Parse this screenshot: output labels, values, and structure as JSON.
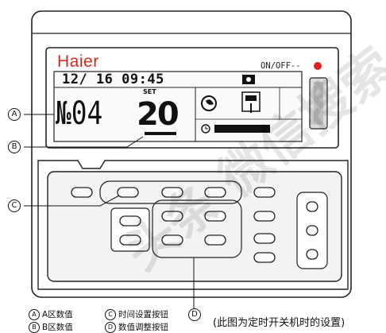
{
  "display": {
    "brand": "Haier",
    "on_off_label": "ON/OFF--",
    "datetime": "12/ 16 09:45",
    "zone_a_value": "№04",
    "set_label": "SET",
    "zone_b_value": "20"
  },
  "callouts": {
    "a": "A",
    "b": "B",
    "c": "C",
    "d": "D"
  },
  "legend": [
    {
      "marker": "A",
      "text": "A区数值"
    },
    {
      "marker": "C",
      "text": "时间设置按钮"
    },
    {
      "marker": "B",
      "text": "B区数值"
    },
    {
      "marker": "D",
      "text": "数值调整按钮"
    }
  ],
  "caption": "(此图为定时开关机时的设置)",
  "watermark": "头条 微信搜索",
  "colors": {
    "brand_red": "#d42a1e",
    "power_led": "#e02020",
    "outline": "#222222",
    "panel_fill": "#f3f3f3"
  }
}
